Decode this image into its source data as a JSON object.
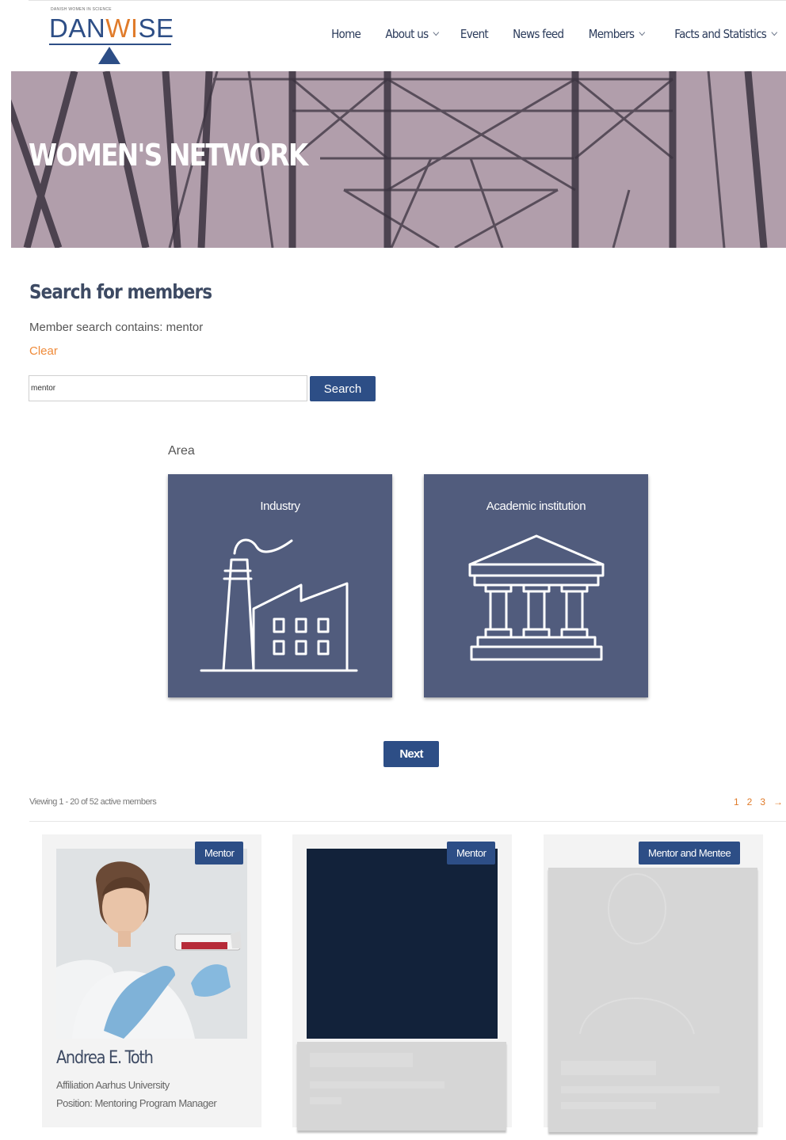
{
  "header": {
    "logo": {
      "tagline": "DANISH WOMEN IN SCIENCE",
      "word_dan": "DAN",
      "word_wi": "WI",
      "word_se": "SE"
    },
    "nav": [
      {
        "label": "Home",
        "has_dropdown": false
      },
      {
        "label": "About us",
        "has_dropdown": true
      },
      {
        "label": "Event",
        "has_dropdown": false
      },
      {
        "label": "News feed",
        "has_dropdown": false
      },
      {
        "label": "Members",
        "has_dropdown": true
      },
      {
        "label": "Facts and Statistics",
        "has_dropdown": true
      }
    ]
  },
  "hero": {
    "title": "WOMEN'S NETWORK"
  },
  "search": {
    "title": "Search for members",
    "summary": "Member search contains: mentor",
    "clear_label": "Clear",
    "input_value": "mentor",
    "button_label": "Search"
  },
  "area": {
    "label": "Area",
    "options": [
      {
        "label": "Industry",
        "icon": "factory-icon"
      },
      {
        "label": "Academic institution",
        "icon": "institution-icon"
      }
    ],
    "next_label": "Next"
  },
  "results": {
    "viewing": "Viewing 1 - 20 of 52 active members",
    "pages": [
      "1",
      "2",
      "3",
      "→"
    ],
    "members": [
      {
        "badge": "Mentor",
        "name": "Andrea E. Toth",
        "affiliation": "Affiliation Aarhus University",
        "position": "Position: Mentoring Program Manager"
      },
      {
        "badge": "Mentor"
      },
      {
        "badge": "Mentor and Mentee"
      }
    ]
  },
  "colors": {
    "brand_blue": "#2d4e86",
    "accent_orange": "#e07b2a",
    "card_slate": "#515c7d",
    "hero_mauve": "#b19eab"
  }
}
